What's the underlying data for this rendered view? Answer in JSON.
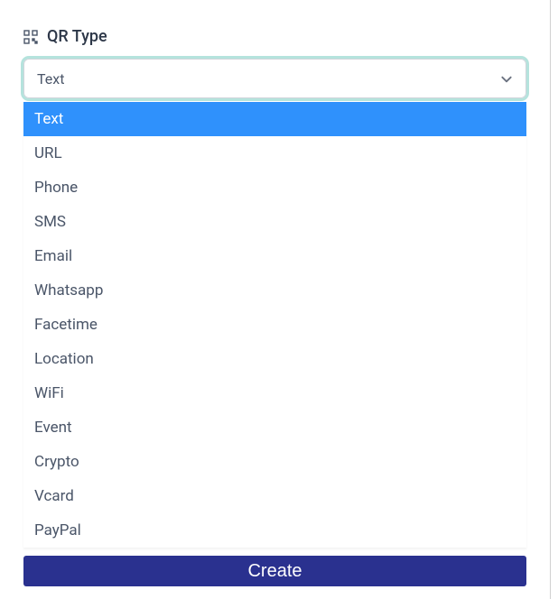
{
  "field": {
    "label": "QR Type",
    "selected": "Text",
    "options": [
      "Text",
      "URL",
      "Phone",
      "SMS",
      "Email",
      "Whatsapp",
      "Facetime",
      "Location",
      "WiFi",
      "Event",
      "Crypto",
      "Vcard",
      "PayPal"
    ]
  },
  "actions": {
    "create_label": "Create"
  },
  "colors": {
    "primary_button": "#2a318f",
    "option_selected_bg": "#2f91fc",
    "focus_ring": "#b5e3dd"
  }
}
